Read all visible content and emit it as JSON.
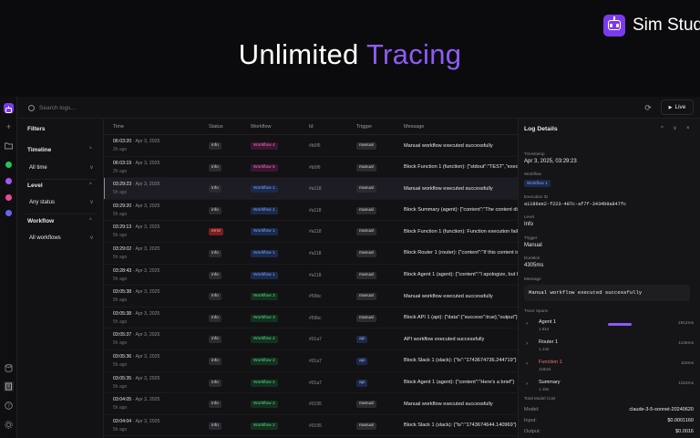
{
  "hero": {
    "title_part1": "Unlimited",
    "title_part2": "Tracing",
    "brand": "Sim Stud",
    "colors": {
      "accent": "#8f5cf7",
      "brand_logo": "#7c3aed",
      "background": "#0b0b0d"
    }
  },
  "toolbar": {
    "search_placeholder": "Search logs...",
    "live_label": "Live",
    "refresh_icon": "refresh-icon"
  },
  "rail": {
    "items": [
      "logo-icon",
      "plus-icon",
      "folder-icon",
      "green-dot",
      "purple-dot",
      "pink-dot",
      "blue-dot",
      "database-icon",
      "logs-icon",
      "help-icon",
      "settings-icon"
    ],
    "dot_colors": [
      "#22c55e",
      "#a855f7",
      "#ec4899",
      "#6366f1"
    ]
  },
  "filters": {
    "title": "Filters",
    "timeline": {
      "label": "Timeline",
      "value": "All time"
    },
    "level": {
      "label": "Level",
      "value": "Any status"
    },
    "workflow": {
      "label": "Workflow",
      "value": "All workflows"
    }
  },
  "table": {
    "headers": {
      "time": "Time",
      "status": "Status",
      "workflow": "Workflow",
      "id": "Id",
      "trigger": "Trigger",
      "message": "Message"
    },
    "rows": [
      {
        "time": "06:03:20",
        "date": "Apr 3, 2025",
        "ago": "2h ago",
        "status": "info",
        "workflow": "Workflow 4",
        "wf_color": "#f472b6",
        "wf_bg": "#3a1730",
        "id": "#b0f6",
        "trigger": "manual",
        "message": "Manual workflow executed successfully"
      },
      {
        "time": "06:03:19",
        "date": "Apr 3, 2025",
        "ago": "2h ago",
        "status": "info",
        "workflow": "Workflow 5",
        "wf_color": "#f472b6",
        "wf_bg": "#3a1730",
        "id": "#b0f6",
        "trigger": "manual",
        "message": "Block Function 1 (function): {\"stdout\":\"TEST\",\"executionTime\":1}"
      },
      {
        "time": "03:29:23",
        "date": "Apr 3, 2025",
        "ago": "5h ago",
        "status": "info",
        "workflow": "Workflow 1",
        "wf_color": "#7ea2ff",
        "wf_bg": "#1b2a4a",
        "id": "#a118",
        "trigger": "manual",
        "message": "Manual workflow executed successfully",
        "selected": true
      },
      {
        "time": "03:29:20",
        "date": "Apr 3, 2025",
        "ago": "5h ago",
        "status": "info",
        "workflow": "Workflow 1",
        "wf_color": "#7ea2ff",
        "wf_bg": "#1b2a4a",
        "id": "#a118",
        "trigger": "manual",
        "message": "Block Summary (agent): {\"content\":\"The content discusses\"}"
      },
      {
        "time": "03:29:13",
        "date": "Apr 3, 2025",
        "ago": "5h ago",
        "status": "error",
        "workflow": "Workflow 1",
        "wf_color": "#7ea2ff",
        "wf_bg": "#1b2a4a",
        "id": "#a118",
        "trigger": "manual",
        "message": "Block Function 1 (function): Function execution failed"
      },
      {
        "time": "03:29:02",
        "date": "Apr 3, 2025",
        "ago": "5h ago",
        "status": "info",
        "workflow": "Workflow 1",
        "wf_color": "#7ea2ff",
        "wf_bg": "#1b2a4a",
        "id": "#a118",
        "trigger": "manual",
        "message": "Block Router 1 (router): {\"content\":\"If this content is\"}"
      },
      {
        "time": "03:28:43",
        "date": "Apr 3, 2025",
        "ago": "5h ago",
        "status": "info",
        "workflow": "Workflow 1",
        "wf_color": "#7ea2ff",
        "wf_bg": "#1b2a4a",
        "id": "#a118",
        "trigger": "manual",
        "message": "Block Agent 1 (agent): {\"content\":\"I apologize, but I\"}"
      },
      {
        "time": "03:05:38",
        "date": "Apr 3, 2025",
        "ago": "5h ago",
        "status": "info",
        "workflow": "Workflow 3",
        "wf_color": "#4ade80",
        "wf_bg": "#15301f",
        "id": "#59bc",
        "trigger": "manual",
        "message": "Manual workflow executed successfully"
      },
      {
        "time": "03:05:38",
        "date": "Apr 3, 2025",
        "ago": "5h ago",
        "status": "info",
        "workflow": "Workflow 3",
        "wf_color": "#4ade80",
        "wf_bg": "#15301f",
        "id": "#59bc",
        "trigger": "manual",
        "message": "Block API 1 (api): {\"data\":{\"success\":true},\"output\"}"
      },
      {
        "time": "03:05:37",
        "date": "Apr 3, 2025",
        "ago": "5h ago",
        "status": "info",
        "workflow": "Workflow 2",
        "wf_color": "#4ade80",
        "wf_bg": "#15301f",
        "id": "#01a7",
        "trigger": "api",
        "message": "API workflow executed successfully"
      },
      {
        "time": "03:05:36",
        "date": "Apr 3, 2025",
        "ago": "5h ago",
        "status": "info",
        "workflow": "Workflow 2",
        "wf_color": "#4ade80",
        "wf_bg": "#15301f",
        "id": "#01a7",
        "trigger": "api",
        "message": "Block Slack 1 (slack): {\"ts\":\"1743674736.244719\"}"
      },
      {
        "time": "03:05:35",
        "date": "Apr 3, 2025",
        "ago": "5h ago",
        "status": "info",
        "workflow": "Workflow 2",
        "wf_color": "#4ade80",
        "wf_bg": "#15301f",
        "id": "#01a7",
        "trigger": "api",
        "message": "Block Agent 1 (agent): {\"content\":\"Here's a brief\"}"
      },
      {
        "time": "03:04:05",
        "date": "Apr 3, 2025",
        "ago": "5h ago",
        "status": "info",
        "workflow": "Workflow 2",
        "wf_color": "#4ade80",
        "wf_bg": "#15301f",
        "id": "#0195",
        "trigger": "manual",
        "message": "Manual workflow executed successfully"
      },
      {
        "time": "03:04:04",
        "date": "Apr 3, 2025",
        "ago": "5h ago",
        "status": "info",
        "workflow": "Workflow 2",
        "wf_color": "#4ade80",
        "wf_bg": "#15301f",
        "id": "#0195",
        "trigger": "manual",
        "message": "Block Slack 1 (slack): {\"ts\":\"1743674644.140969\"}"
      }
    ]
  },
  "details": {
    "title": "Log Details",
    "timestamp_label": "Timestamp",
    "timestamp": "Apr 3, 2025, 03:29:23",
    "workflow_label": "Workflow",
    "workflow": "Workflow 1",
    "execution_id_label": "Execution ID",
    "execution_id": "a1186ee2-f223-487c-af7f-3434b9a847fc",
    "level_label": "Level",
    "level": "Info",
    "trigger_label": "Trigger",
    "trigger": "Manual",
    "duration_label": "Duration",
    "duration": "4305ms",
    "message_label": "Message",
    "message": "Manual workflow executed successfully",
    "trace_label": "Trace Spans",
    "spans": [
      {
        "name": "Agent 1",
        "ms": "1.81s",
        "duration": "1812ms",
        "bar_color": "#8b5cf6",
        "bar_fraction": 0.42,
        "bar_offset": 0.0,
        "name_color": "#e8e8ea"
      },
      {
        "name": "Router 1",
        "ms": "1.14s",
        "duration": "1146ms",
        "bar_color": "#22c55e",
        "bar_fraction": 0.0,
        "bar_offset": 0.42,
        "name_color": "#e8e8ea"
      },
      {
        "name": "Function 1",
        "ms": "116ms",
        "duration": "116ms",
        "bar_color": "#ef4444",
        "bar_fraction": 0.0,
        "bar_offset": 0.69,
        "name_color": "#f87171"
      },
      {
        "name": "Summary",
        "ms": "1.15s",
        "duration": "1153ms",
        "bar_color": "#8b5cf6",
        "bar_fraction": 0.0,
        "bar_offset": 0.72,
        "name_color": "#e8e8ea"
      }
    ],
    "cost_label": "Total Model Cost",
    "model_label": "Model:",
    "model": "claude-3-5-sonnet-20240620",
    "input_label": "Input:",
    "input": "$0.0001160",
    "output_label": "Output:",
    "output": "$0.0016"
  }
}
